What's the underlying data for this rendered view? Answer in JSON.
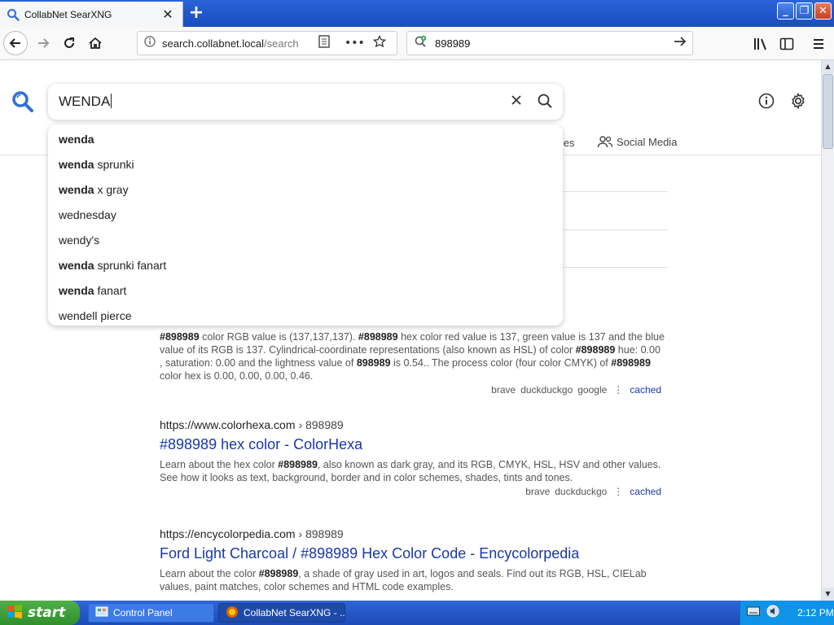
{
  "browser": {
    "tab_title": "CollabNet SearXNG",
    "new_tab_symbol": "+",
    "url_scheme_hidden": "",
    "url_host": "search.collabnet.local",
    "url_path": "/search",
    "search_bar_value": "898989"
  },
  "searx": {
    "query": "WENDA",
    "categories": {
      "files_partial": "files",
      "social_media": "Social Media"
    },
    "autocomplete": [
      {
        "bold": "wenda",
        "rest": ""
      },
      {
        "bold": "wenda",
        "rest": " sprunki"
      },
      {
        "bold": "wenda",
        "rest": " x gray"
      },
      {
        "bold": "",
        "rest": "wednesday"
      },
      {
        "bold": "",
        "rest": "wendy's"
      },
      {
        "bold": "wenda",
        "rest": " sprunki fanart"
      },
      {
        "bold": "wenda",
        "rest": " fanart"
      },
      {
        "bold": "",
        "rest": "wendell pierce"
      }
    ],
    "results": [
      {
        "content_html": "<b>#898989</b> color RGB value is (137,137,137). <b>#898989</b> hex color red value is 137, green value is 137 and the blue value of its RGB is 137. Cylindrical-coordinate representations (also known as HSL) of color <b>#898989</b> hue: 0.00 , saturation: 0.00 and the lightness value of <b>898989</b> is 0.54.. The process color (four color CMYK) of <b>#898989</b> color hex is 0.00, 0.00, 0.00, 0.46.",
        "engines": [
          "brave",
          "duckduckgo",
          "google"
        ],
        "cached": "cached"
      },
      {
        "url": "https://www.colorhexa.com",
        "crumb": "› 898989",
        "title": "#898989 hex color - ColorHexa",
        "content_html": "Learn about the hex color <b>#898989</b>, also known as dark gray, and its RGB, CMYK, HSL, HSV and other values. See how it looks as text, background, border and in color schemes, shades, tints and tones.",
        "engines": [
          "brave",
          "duckduckgo"
        ],
        "cached": "cached"
      },
      {
        "url": "https://encycolorpedia.com",
        "crumb": "› 898989",
        "title": "Ford Light Charcoal / #898989 Hex Color Code - Encycolorpedia",
        "content_html": "Learn about the color <b>#898989</b>, a shade of gray used in art, logos and seals. Find out its RGB, HSL, CIELab values, paint matches, color schemes and HTML code examples."
      }
    ]
  },
  "taskbar": {
    "start_label": "start",
    "tasks": [
      "Control Panel",
      "CollabNet SearXNG - ..."
    ],
    "clock": "2:12 PM"
  },
  "colors": {
    "accent_blue": "#1a38a8",
    "searx_logo_blue": "#2f6fd6",
    "xp_taskbar": "#2456c7"
  }
}
